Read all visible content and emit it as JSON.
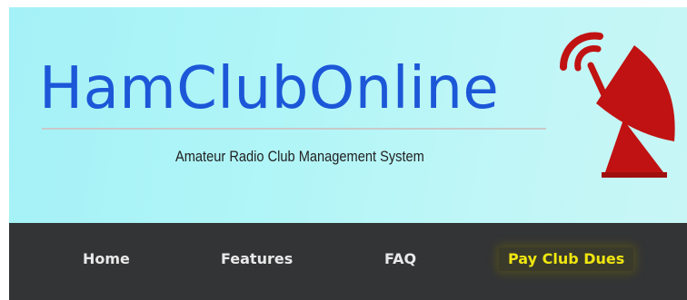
{
  "header": {
    "logo_text": "HamClubOnline",
    "tagline": "Amateur Radio Club Management System",
    "logo_icon": "satellite-dish-icon"
  },
  "nav": {
    "items": [
      {
        "label": "Home"
      },
      {
        "label": "Features"
      },
      {
        "label": "FAQ"
      },
      {
        "label": "Pay Club Dues",
        "highlighted": true
      }
    ]
  },
  "colors": {
    "brand_blue": "#1c57d8",
    "dish_red": "#c01212",
    "nav_background": "#333436",
    "nav_text": "#e9e9e9",
    "highlight_yellow": "#f0e610"
  }
}
